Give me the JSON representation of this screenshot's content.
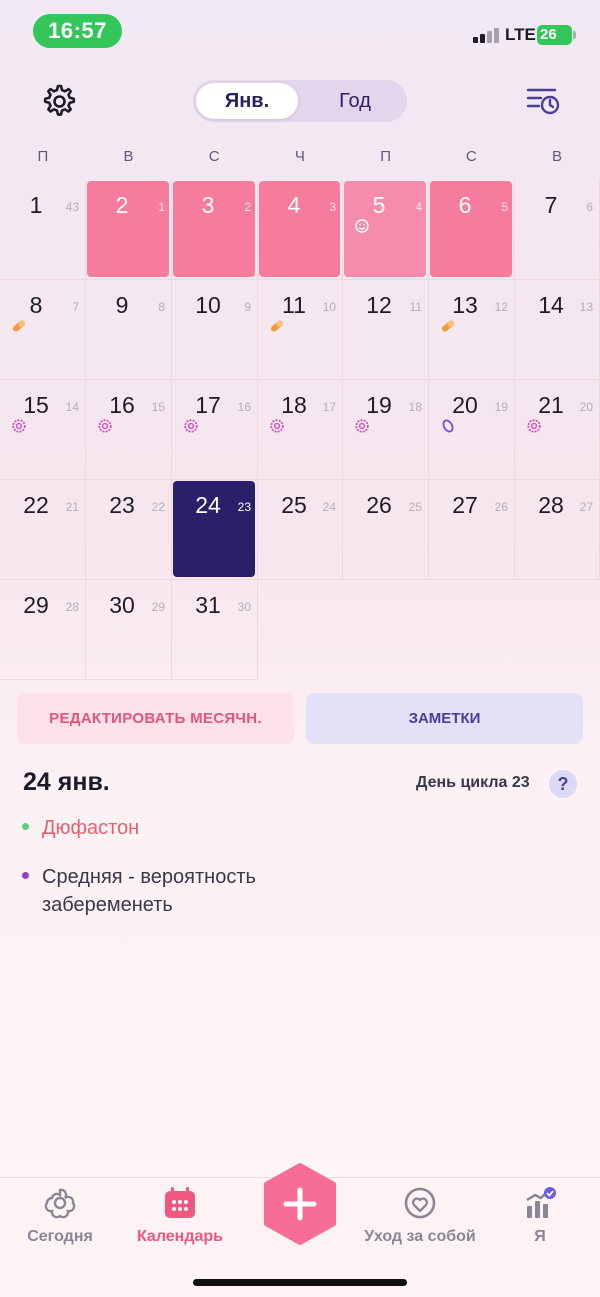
{
  "status_bar": {
    "time": "16:57",
    "network": "LTE",
    "battery": "26"
  },
  "header": {
    "tabs": [
      {
        "label": "Янв."
      },
      {
        "label": "Год"
      }
    ]
  },
  "weekdays": [
    "П",
    "В",
    "С",
    "Ч",
    "П",
    "С",
    "В"
  ],
  "calendar": {
    "days": [
      {
        "d": "1",
        "c": "43",
        "state": "",
        "icon": ""
      },
      {
        "d": "2",
        "c": "1",
        "state": "period",
        "icon": ""
      },
      {
        "d": "3",
        "c": "2",
        "state": "period",
        "icon": ""
      },
      {
        "d": "4",
        "c": "3",
        "state": "period",
        "icon": ""
      },
      {
        "d": "5",
        "c": "4",
        "state": "period light",
        "icon": "smiley-icon"
      },
      {
        "d": "6",
        "c": "5",
        "state": "period",
        "icon": ""
      },
      {
        "d": "7",
        "c": "6",
        "state": "",
        "icon": ""
      },
      {
        "d": "8",
        "c": "7",
        "state": "",
        "icon": "pill-icon"
      },
      {
        "d": "9",
        "c": "8",
        "state": "",
        "icon": ""
      },
      {
        "d": "10",
        "c": "9",
        "state": "",
        "icon": ""
      },
      {
        "d": "11",
        "c": "10",
        "state": "",
        "icon": "pill-icon"
      },
      {
        "d": "12",
        "c": "11",
        "state": "",
        "icon": ""
      },
      {
        "d": "13",
        "c": "12",
        "state": "",
        "icon": "pill-icon"
      },
      {
        "d": "14",
        "c": "13",
        "state": "",
        "icon": ""
      },
      {
        "d": "15",
        "c": "14",
        "state": "",
        "icon": "flower-icon"
      },
      {
        "d": "16",
        "c": "15",
        "state": "",
        "icon": "flower-icon"
      },
      {
        "d": "17",
        "c": "16",
        "state": "",
        "icon": "flower-icon"
      },
      {
        "d": "18",
        "c": "17",
        "state": "",
        "icon": "flower-icon"
      },
      {
        "d": "19",
        "c": "18",
        "state": "",
        "icon": "flower-icon"
      },
      {
        "d": "20",
        "c": "19",
        "state": "",
        "icon": "ovulation-icon"
      },
      {
        "d": "21",
        "c": "20",
        "state": "",
        "icon": "flower-icon"
      },
      {
        "d": "22",
        "c": "21",
        "state": "",
        "icon": ""
      },
      {
        "d": "23",
        "c": "22",
        "state": "",
        "icon": ""
      },
      {
        "d": "24",
        "c": "23",
        "state": "selected",
        "icon": ""
      },
      {
        "d": "25",
        "c": "24",
        "state": "",
        "icon": ""
      },
      {
        "d": "26",
        "c": "25",
        "state": "",
        "icon": ""
      },
      {
        "d": "27",
        "c": "26",
        "state": "",
        "icon": ""
      },
      {
        "d": "28",
        "c": "27",
        "state": "",
        "icon": ""
      },
      {
        "d": "29",
        "c": "28",
        "state": "",
        "icon": ""
      },
      {
        "d": "30",
        "c": "29",
        "state": "",
        "icon": ""
      },
      {
        "d": "31",
        "c": "30",
        "state": "",
        "icon": ""
      }
    ]
  },
  "actions": {
    "edit_label": "РЕДАКТИРОВАТЬ МЕСЯЧН.",
    "notes_label": "ЗАМЕТКИ"
  },
  "details": {
    "date": "24 янв.",
    "cycle_day": "День цикла 23",
    "help": "?",
    "notes": [
      "Дюфастон",
      "Средняя - вероятность забеременеть"
    ]
  },
  "tabbar": {
    "tabs": [
      {
        "label": "Сегодня"
      },
      {
        "label": "Календарь"
      },
      {
        "label": "Уход за собой"
      },
      {
        "label": "Я"
      }
    ]
  },
  "colors": {
    "period": "#f67c9e",
    "selected": "#2b1f6c",
    "accent": "#f0577f"
  }
}
